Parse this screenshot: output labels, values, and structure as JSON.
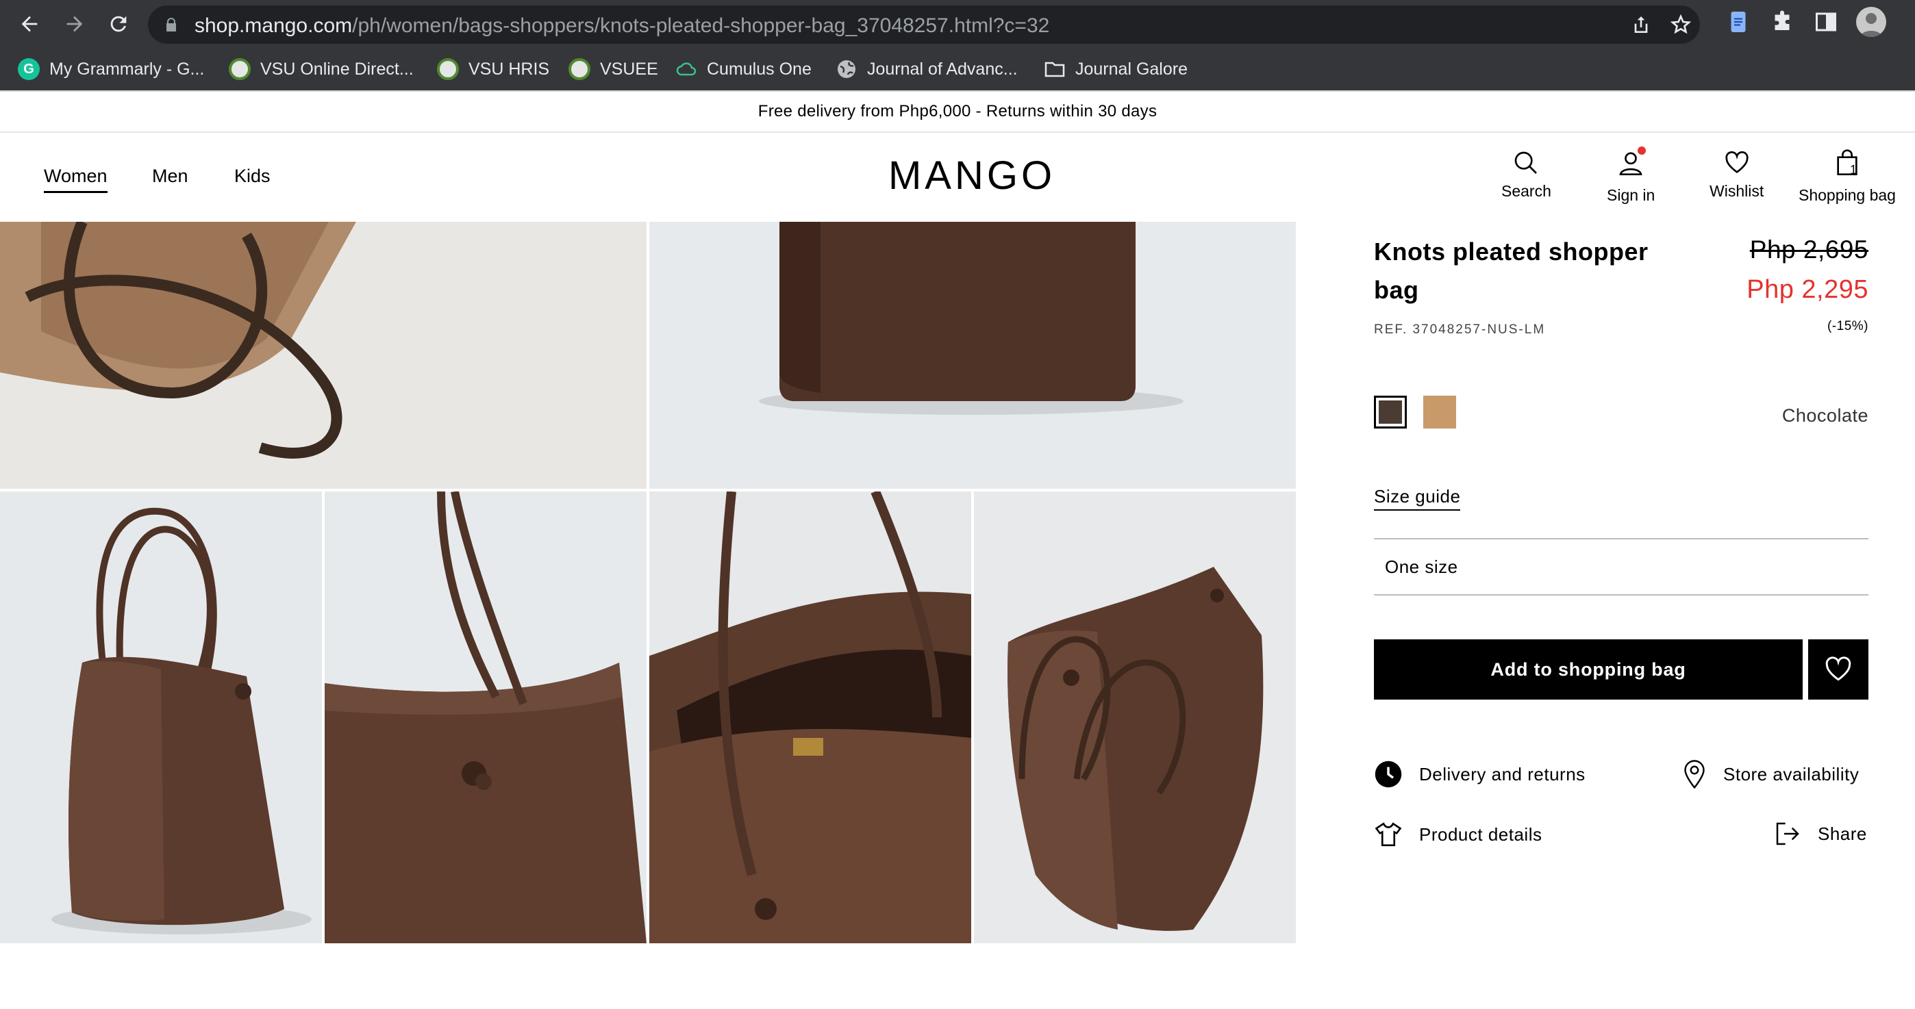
{
  "browser": {
    "url_host": "shop.mango.com",
    "url_path": "/ph/women/bags-shoppers/knots-pleated-shopper-bag_37048257.html?c=32",
    "bookmarks": [
      {
        "label": "My Grammarly - G...",
        "icon": "grammarly-icon"
      },
      {
        "label": "VSU Online Direct...",
        "icon": "vsu-seal-icon"
      },
      {
        "label": "VSU HRIS",
        "icon": "vsu-seal-icon"
      },
      {
        "label": "VSUEE",
        "icon": "vsu-seal-icon"
      },
      {
        "label": "Cumulus One",
        "icon": "cloud-icon"
      },
      {
        "label": "Journal of Advanc...",
        "icon": "globe-icon"
      },
      {
        "label": "Journal Galore",
        "icon": "folder-icon"
      }
    ]
  },
  "announcement": "Free delivery from Php6,000 - Returns within 30 days",
  "header": {
    "nav": [
      "Women",
      "Men",
      "Kids"
    ],
    "logo": "MANGO",
    "actions": {
      "search": "Search",
      "sign_in": "Sign in",
      "wishlist": "Wishlist",
      "shopping_bag": "Shopping bag",
      "bag_count": "1"
    }
  },
  "product": {
    "title": "Knots pleated shopper bag",
    "old_price": "Php 2,695",
    "new_price": "Php 2,295",
    "discount": "(-15%)",
    "ref": "REF. 37048257-NUS-LM",
    "colors": [
      {
        "name": "Chocolate",
        "hex": "#4a3b33",
        "selected": true
      },
      {
        "name": "Tan",
        "hex": "#c89a6a",
        "selected": false
      }
    ],
    "selected_color": "Chocolate",
    "size_guide": "Size guide",
    "size": "One size",
    "add_to_bag": "Add to shopping bag",
    "links": {
      "delivery": "Delivery and returns",
      "store": "Store availability",
      "details": "Product details",
      "share": "Share"
    }
  },
  "colors": {
    "chrome_bg": "#35363a",
    "omnibox_bg": "#202124",
    "sale_red": "#e4322e",
    "bag_brown": "#5b3a2c"
  }
}
